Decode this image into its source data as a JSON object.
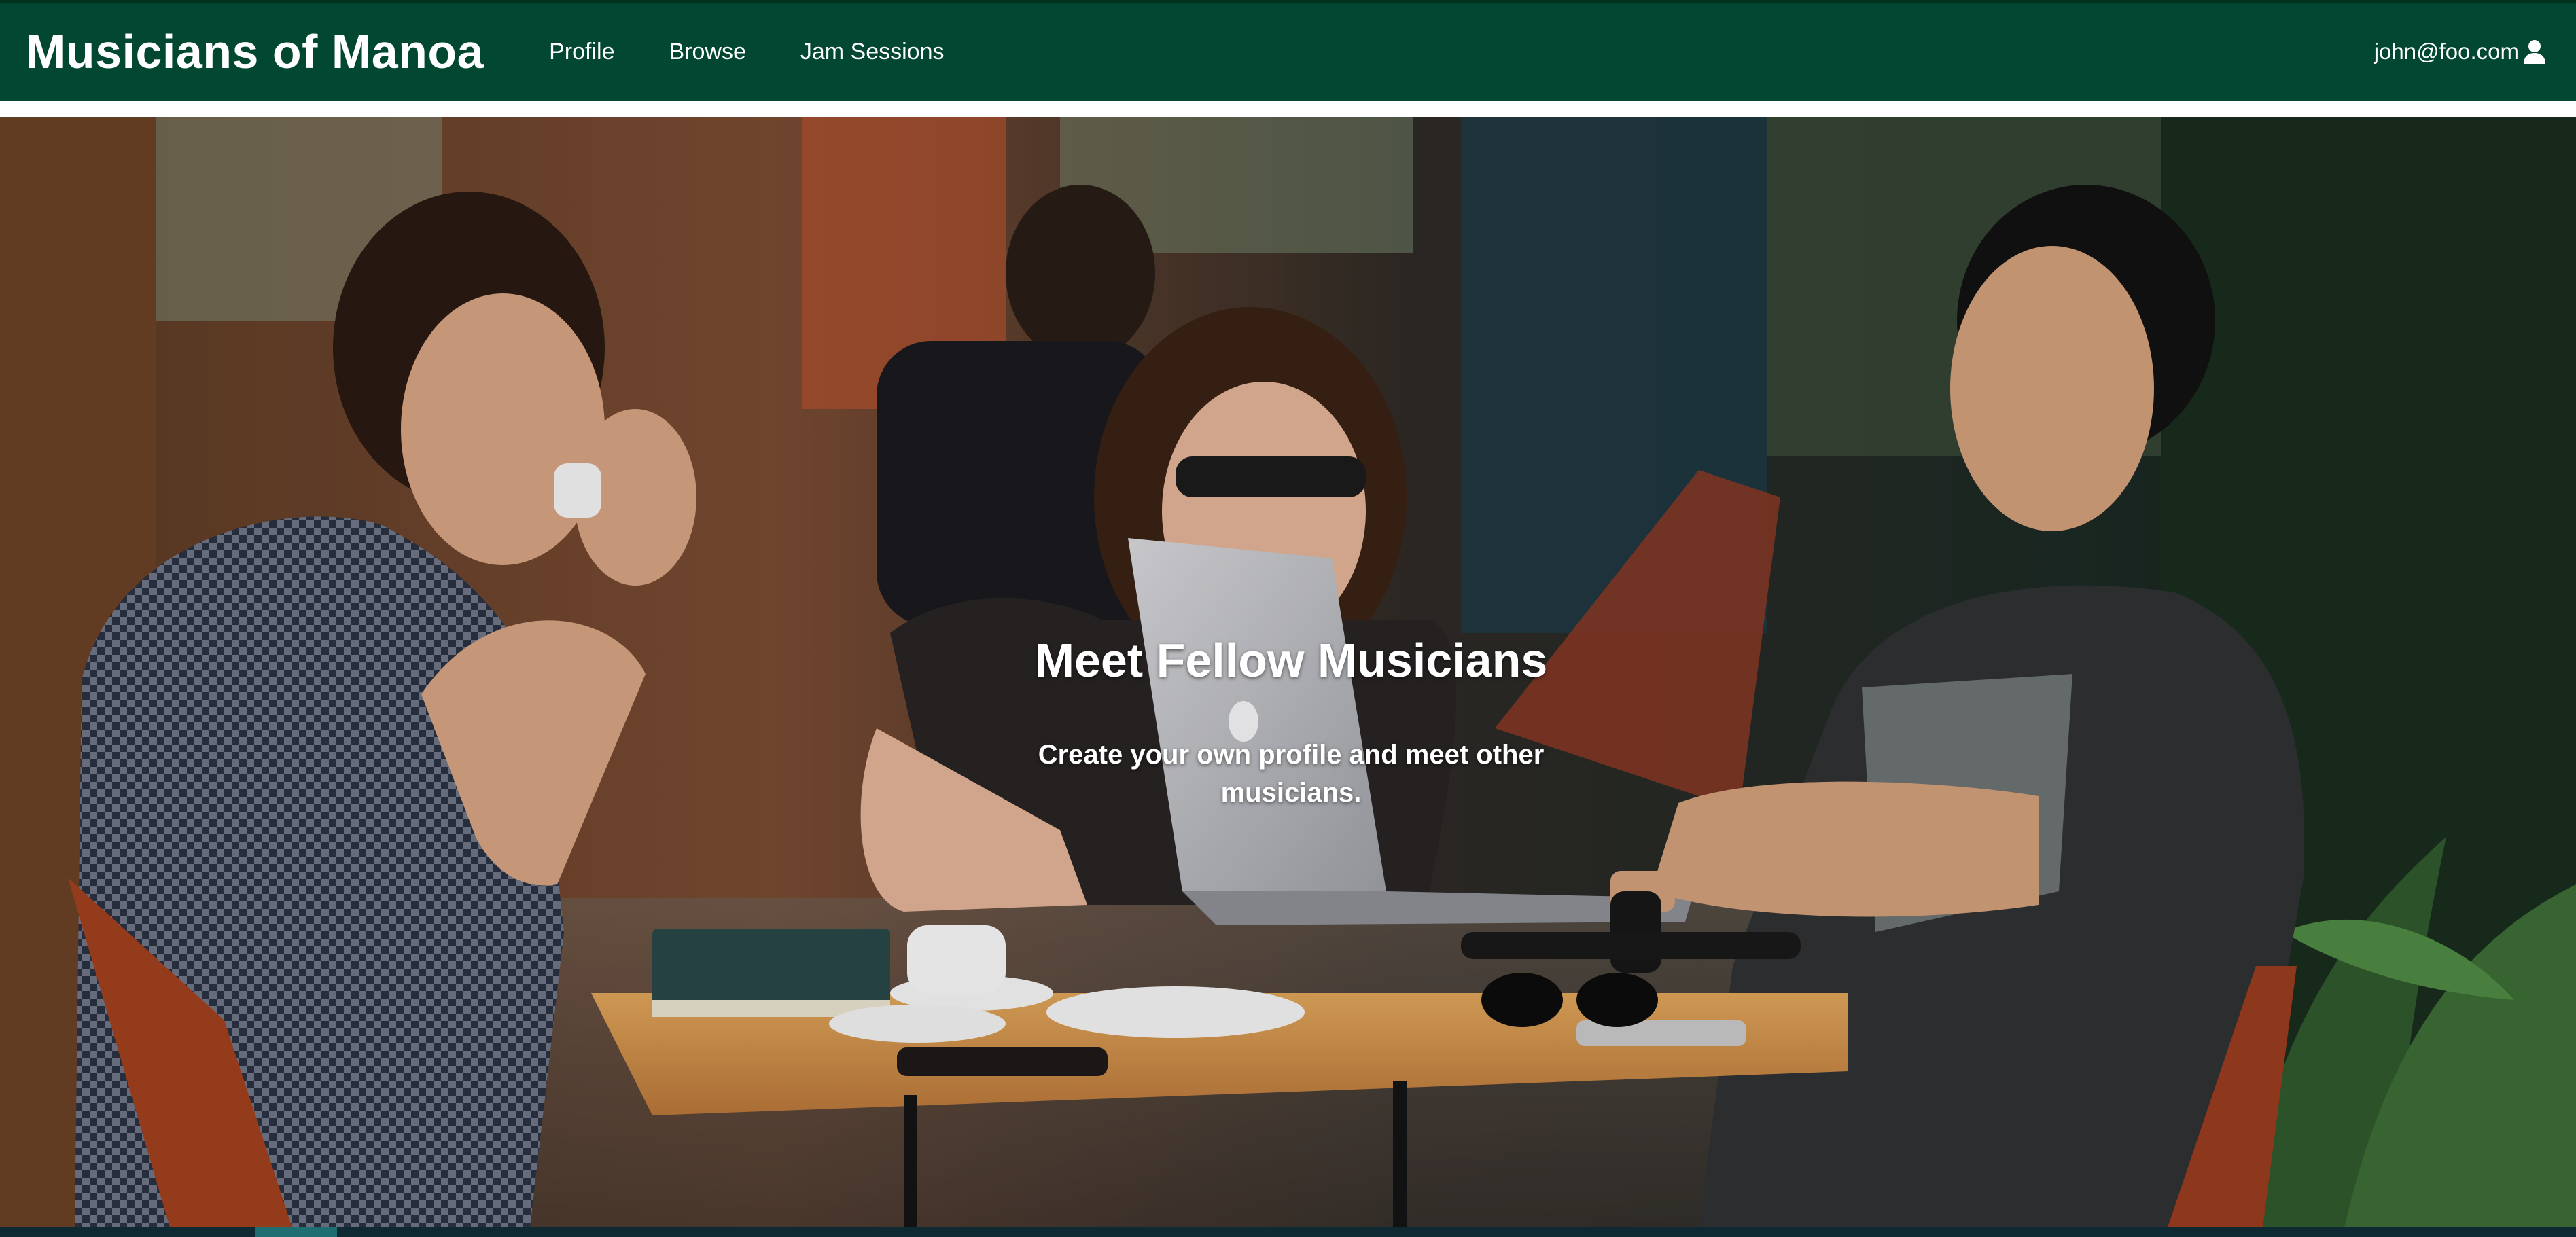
{
  "navbar": {
    "brand": "Musicians of Manoa",
    "links": [
      {
        "label": "Profile"
      },
      {
        "label": "Browse"
      },
      {
        "label": "Jam Sessions"
      }
    ],
    "user_email": "john@foo.com",
    "user_icon": "user-icon"
  },
  "hero": {
    "title": "Meet Fellow Musicians",
    "subtitle": "Create your own profile and meet other musicians."
  },
  "colors": {
    "navbar_bg": "#024731",
    "text": "#ffffff"
  }
}
